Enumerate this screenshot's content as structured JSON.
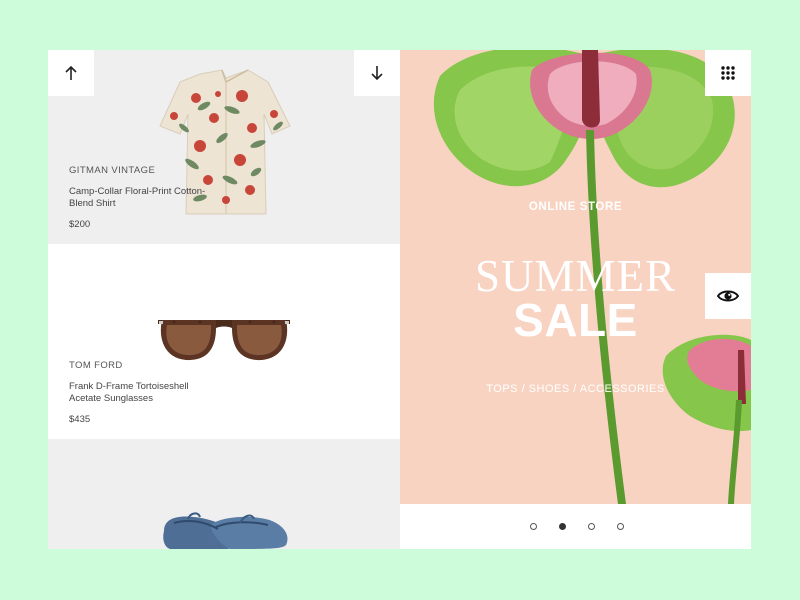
{
  "products": [
    {
      "brand": "GITMAN VINTAGE",
      "name": "Camp-Collar Floral-Print Cotton-Blend Shirt",
      "price": "$200",
      "icon": "floral-shirt-image"
    },
    {
      "brand": "TOM FORD",
      "name": "Frank D-Frame Tortoiseshell Acetate Sunglasses",
      "price": "$435",
      "icon": "sunglasses-image"
    },
    {
      "icon": "loafers-image"
    }
  ],
  "nav": {
    "up_icon": "arrow-up-icon",
    "down_icon": "arrow-down-icon"
  },
  "hero": {
    "eyebrow": "ONLINE STORE",
    "title_line1": "SUMMER",
    "title_line2": "SALE",
    "categories": "TOPS / SHOES / ACCESSORIES",
    "background_color": "#f8d3c2",
    "menu_icon": "grid-menu-icon",
    "quick_view_icon": "eye-icon"
  },
  "slider": {
    "slide_count": 4,
    "active_index": 1
  },
  "colors": {
    "page_background": "#ccfcda",
    "card_gray": "#efefef"
  }
}
